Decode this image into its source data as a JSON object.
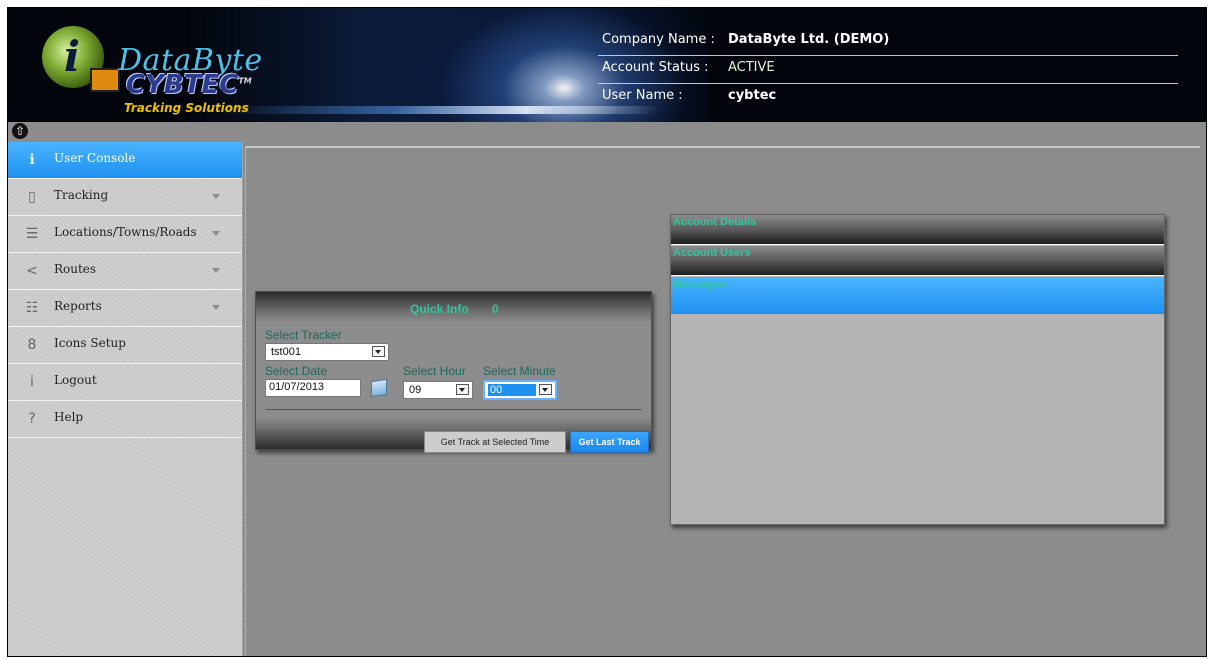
{
  "header": {
    "logo": {
      "line1": "DataByte",
      "line2": "CYBTEC",
      "trademark": "TM",
      "tagline": "Tracking Solutions"
    },
    "company_name_label": "Company Name :",
    "company_name": "DataByte Ltd. (DEMO)",
    "account_status_label": "Account Status :",
    "account_status": "ACTIVE",
    "user_name_label": "User Name :",
    "user_name": "cybtec"
  },
  "sidebar": {
    "items": [
      {
        "label": "User Console",
        "icon": "info-icon",
        "glyph": "ℹ",
        "active": true,
        "has_submenu": false
      },
      {
        "label": "Tracking",
        "icon": "file-icon",
        "glyph": "🗋",
        "active": false,
        "has_submenu": true
      },
      {
        "label": "Locations/Towns/Roads",
        "icon": "list-icon",
        "glyph": "☰",
        "active": false,
        "has_submenu": true
      },
      {
        "label": "Routes",
        "icon": "share-icon",
        "glyph": "≺",
        "active": false,
        "has_submenu": true
      },
      {
        "label": "Reports",
        "icon": "list-bullets-icon",
        "glyph": "☷",
        "active": false,
        "has_submenu": true
      },
      {
        "label": "Icons Setup",
        "icon": "link-icon",
        "glyph": "8",
        "active": false,
        "has_submenu": false
      },
      {
        "label": "Logout",
        "icon": "info-icon",
        "glyph": "i",
        "active": false,
        "has_submenu": false
      },
      {
        "label": "Help",
        "icon": "question-icon",
        "glyph": "?",
        "active": false,
        "has_submenu": false
      }
    ]
  },
  "quick_info": {
    "title": "Quick Info",
    "count": "0",
    "tracker_label": "Select Tracker",
    "tracker_value": "tst001",
    "date_label": "Select Date",
    "date_value": "01/07/2013",
    "hour_label": "Select Hour",
    "hour_value": "09",
    "minute_label": "Select Minute",
    "minute_value": "00",
    "btn_selected_time": "Get Track at Selected Time",
    "btn_last_track": "Get Last Track"
  },
  "accordion": {
    "sections": [
      "Account Details",
      "Account Users",
      "Messages"
    ],
    "active_section": "Messages"
  },
  "colors": {
    "accent_blue": "#1e90f0",
    "teal_text": "#2fc6a0",
    "panel_gray": "#8c8c8c"
  }
}
